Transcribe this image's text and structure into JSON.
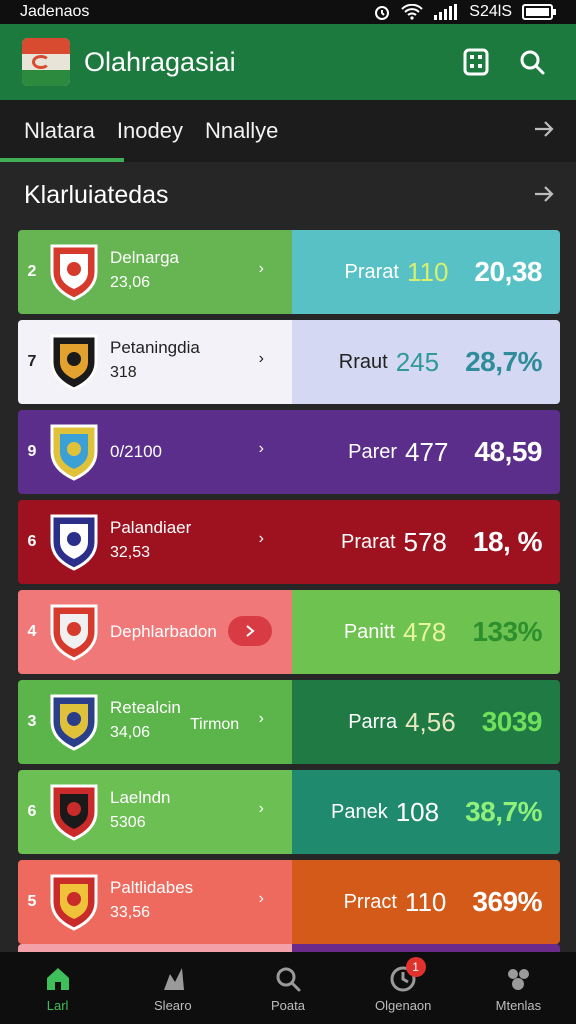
{
  "status_bar": {
    "carrier": "Jadenaos",
    "time": "S24lS"
  },
  "app": {
    "title": "Olahragasiai"
  },
  "tabs": [
    {
      "label": "Nlatara",
      "active": true
    },
    {
      "label": "Inodey"
    },
    {
      "label": "Nnallye"
    }
  ],
  "section": {
    "title": "Klarluiatedas"
  },
  "teams": [
    {
      "rank": "2",
      "name": "Delnarga",
      "sub": "23,06",
      "label": "Prarat",
      "points": "110",
      "pct": "20,38",
      "left_bg": "#66b552",
      "right_bg": "#58c1c6",
      "text": "#ffffff",
      "points_color": "#d6f06e",
      "pct_color": "#ffffff",
      "crest_colors": [
        "#d63a2c",
        "#ffffff"
      ]
    },
    {
      "rank": "7",
      "name": "Petaningdia",
      "sub": "318",
      "label": "Rraut",
      "points": "245",
      "pct": "28,7%",
      "left_bg": "#f2f2f8",
      "right_bg": "#d5d8f2",
      "text": "#222222",
      "points_color": "#2f9a9a",
      "pct_color": "#2f8c9a",
      "crest_colors": [
        "#1a1a1a",
        "#e2a22d"
      ]
    },
    {
      "rank": "9",
      "name": "0/2100",
      "sub": "",
      "label": "Parer",
      "points": "477",
      "pct": "48,59",
      "left_bg": "#5a2e8a",
      "right_bg": "#5a2e8a",
      "text": "#ffffff",
      "points_color": "#ffffff",
      "pct_color": "#ffffff",
      "crest_colors": [
        "#e0c23a",
        "#3aa0d6"
      ]
    },
    {
      "rank": "6",
      "name": "Palandiaer",
      "sub": "32,53",
      "label": "Prarat",
      "points": "578",
      "pct": "18, %",
      "left_bg": "#9e1220",
      "right_bg": "#9e1220",
      "text": "#ffffff",
      "points_color": "#ffffff",
      "pct_color": "#ffffff",
      "crest_colors": [
        "#2b2f8a",
        "#ffffff"
      ]
    },
    {
      "rank": "4",
      "name": "Dephlarbadon",
      "sub": "",
      "label": "Panitt",
      "points": "478",
      "pct": "133%",
      "left_bg": "#f07878",
      "right_bg": "#6ec24f",
      "text": "#ffffff",
      "points_color": "#e8f5a0",
      "pct_color": "#2e8f2e",
      "crest_colors": [
        "#d63a2c",
        "#f0f0f0"
      ]
    },
    {
      "rank": "3",
      "name": "Retealcin",
      "sub": "34,06",
      "tag": "Tirmon",
      "label": "Parra",
      "points": "4,56",
      "pct": "3039",
      "left_bg": "#5cb54a",
      "right_bg": "#1f7a44",
      "text": "#ffffff",
      "points_color": "#e8e8c0",
      "pct_color": "#6fe05a",
      "crest_colors": [
        "#2a3e8a",
        "#e0c23a"
      ]
    },
    {
      "rank": "6",
      "name": "Laelndn",
      "sub": "5306",
      "label": "Panek",
      "points": "108",
      "pct": "38,7%",
      "left_bg": "#6cbf52",
      "right_bg": "#1f8a6e",
      "text": "#ffffff",
      "points_color": "#ffffff",
      "pct_color": "#8ff07a",
      "crest_colors": [
        "#c92a2a",
        "#1a1a1a"
      ]
    },
    {
      "rank": "5",
      "name": "Paltlidabes",
      "sub": "33,56",
      "label": "Prract",
      "points": "110",
      "pct": "369%",
      "left_bg": "#ee6a5e",
      "right_bg": "#d45a1a",
      "text": "#ffffff",
      "points_color": "#ffffff",
      "pct_color": "#ffffff",
      "crest_colors": [
        "#c92a2a",
        "#f0c23a"
      ]
    },
    {
      "rank": "",
      "name": "",
      "sub": "",
      "label": "",
      "points": "",
      "pct": "",
      "left_bg": "#f4a0a8",
      "right_bg": "#6a2a8a",
      "text": "#ffffff",
      "points_color": "#ffffff",
      "pct_color": "#ffffff",
      "crest_colors": [
        "#2a3e8a",
        "#ffffff"
      ]
    }
  ],
  "bottom_nav": [
    {
      "label": "Larl",
      "icon": "home-icon",
      "active": true
    },
    {
      "label": "Slearo",
      "icon": "stats-icon"
    },
    {
      "label": "Poata",
      "icon": "search-icon"
    },
    {
      "label": "Olgenaon",
      "icon": "clock-icon",
      "badge": "1"
    },
    {
      "label": "Mtenlas",
      "icon": "group-icon"
    }
  ],
  "colors": {
    "appbar": "#1d7a3e",
    "accent": "#3fae55",
    "background": "#262626"
  }
}
